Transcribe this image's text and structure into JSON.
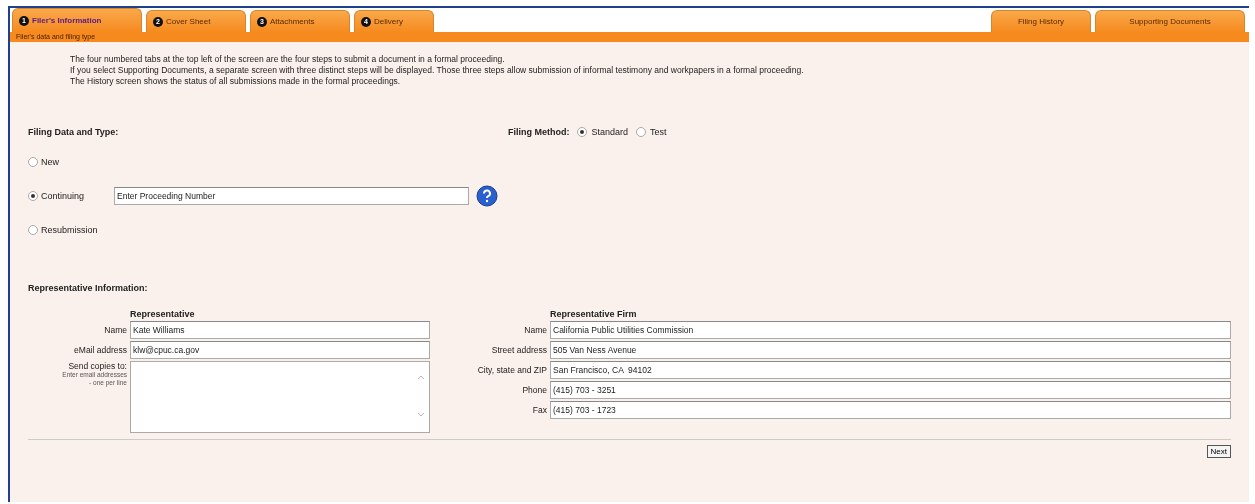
{
  "tabs": [
    {
      "number": "1",
      "label": "Filer's Information",
      "selected": true
    },
    {
      "number": "2",
      "label": "Cover Sheet",
      "selected": false
    },
    {
      "number": "3",
      "label": "Attachments",
      "selected": false
    },
    {
      "number": "4",
      "label": "Delivery",
      "selected": false
    }
  ],
  "right_tabs": [
    {
      "label": "Filing History",
      "selected": false
    },
    {
      "label": "Supporting Documents",
      "selected": false
    }
  ],
  "subtitle": "Filer's data and filing type",
  "intro": [
    "The four numbered tabs at the top left of the screen are the four steps to submit a document in a formal proceeding.",
    "If you select Supporting Documents, a separate screen with three distinct steps will be displayed.  Those three steps allow submission of informal testimony and workpapers in a formal proceeding.",
    "The History screen shows the status of all submissions made in the formal proceedings."
  ],
  "filing_data": {
    "heading": "Filing Data and Type:",
    "options": [
      {
        "label": "New",
        "selected": false
      },
      {
        "label": "Continuing",
        "selected": true,
        "field": "Enter Proceeding Number"
      },
      {
        "label": "Resubmission",
        "selected": false
      }
    ]
  },
  "filing_method": {
    "label": "Filing Method:",
    "options": [
      {
        "label": "Standard",
        "selected": true
      },
      {
        "label": "Test",
        "selected": false
      }
    ]
  },
  "representative_info": {
    "heading": "Representative Information:",
    "representative": {
      "heading": "Representative",
      "fields": [
        {
          "label": "Name",
          "value": "Kate Williams"
        },
        {
          "label": "eMail address",
          "value": "klw@cpuc.ca.gov"
        }
      ],
      "copies": {
        "label": "Send copies to:",
        "hint": "Enter email addresses - one per line"
      }
    },
    "firm": {
      "heading": "Representative Firm",
      "fields": [
        {
          "label": "Name",
          "value": "California Public Utilities Commission"
        },
        {
          "label": "Street address",
          "value": "505 Van Ness Avenue"
        },
        {
          "label": "City, state and ZIP",
          "value": "San Francisco, CA  94102"
        },
        {
          "label": "Phone",
          "value": "(415) 703 - 3251"
        },
        {
          "label": "Fax",
          "value": "(415) 703 - 1723"
        }
      ]
    }
  },
  "next_button": "Next"
}
